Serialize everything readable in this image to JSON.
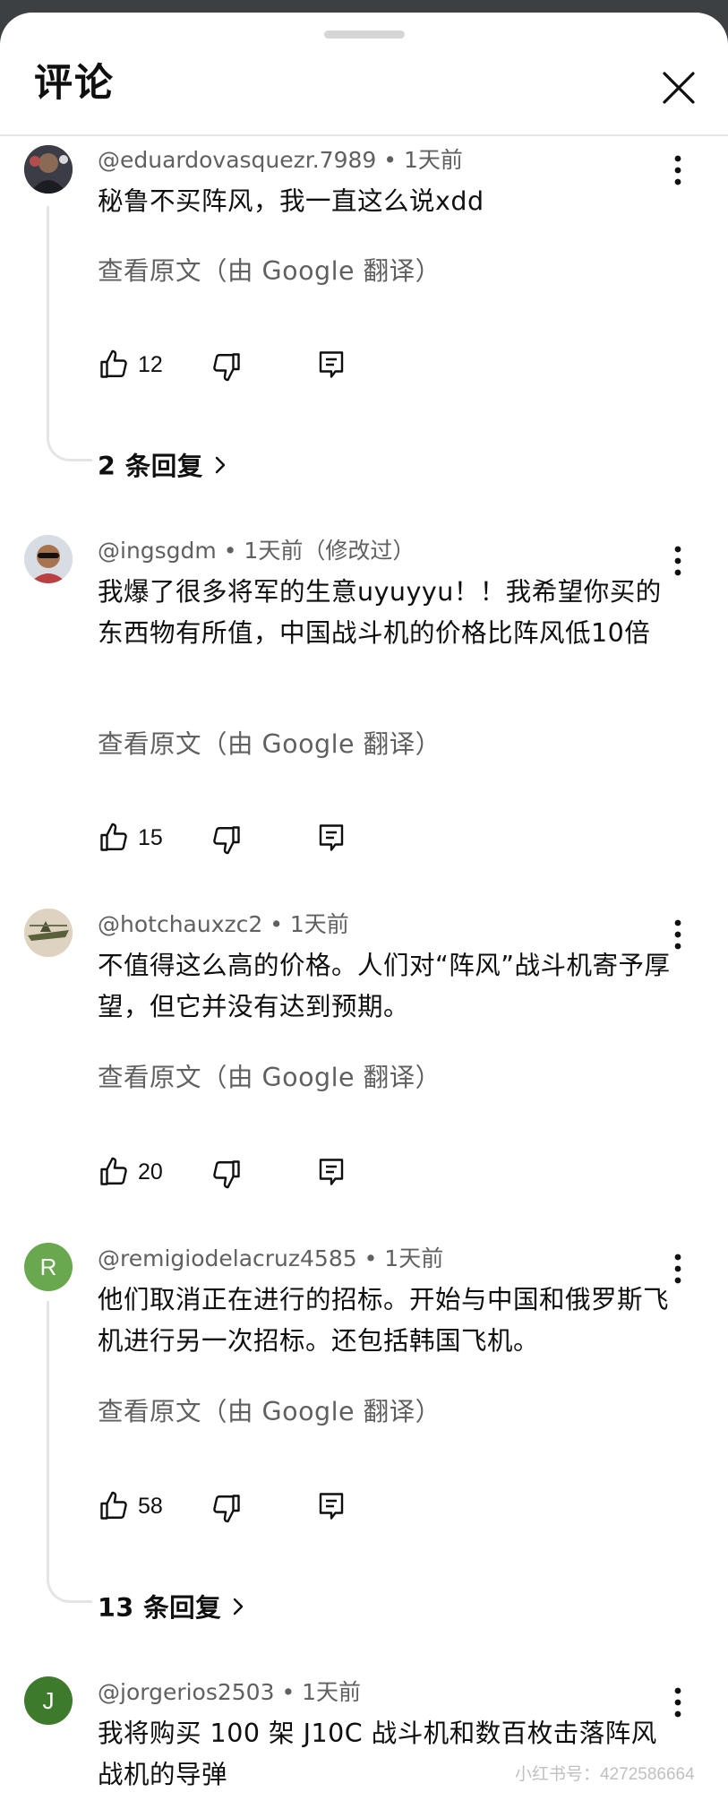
{
  "header": {
    "title": "评论"
  },
  "comments": [
    {
      "meta": "@eduardovasquezr.7989 • 1天前",
      "text": "秘鲁不买阵风，我一直这么说xdd",
      "translate": "查看原文（由 Google 翻译）",
      "likes": "12",
      "replies": "2 条回复"
    },
    {
      "meta": "@ingsgdm • 1天前（修改过）",
      "text": "我爆了很多将军的生意uyuyyu！！我希望你买的东西物有所值，中国战斗机的价格比阵风低10倍",
      "translate": "查看原文（由 Google 翻译）",
      "likes": "15"
    },
    {
      "meta": "@hotchauxzc2 • 1天前",
      "text": "不值得这么高的价格。人们对“阵风”战斗机寄予厚望，但它并没有达到预期。",
      "translate": "查看原文（由 Google 翻译）",
      "likes": "20"
    },
    {
      "meta": "@remigiodelacruz4585 • 1天前",
      "avatar_letter": "R",
      "avatar_color": "#6aa84f",
      "text": "他们取消正在进行的招标。开始与中国和俄罗斯飞机进行另一次招标。还包括韩国飞机。",
      "translate": "查看原文（由 Google 翻译）",
      "likes": "58",
      "replies": "13 条回复"
    },
    {
      "meta": "@jorgerios2503 • 1天前",
      "avatar_letter": "J",
      "avatar_color": "#3d7a2c",
      "text": "我将购买 100 架 J10C 战斗机和数百枚击落阵风战机的导弹"
    }
  ],
  "watermark": "小红书号：4272586664"
}
